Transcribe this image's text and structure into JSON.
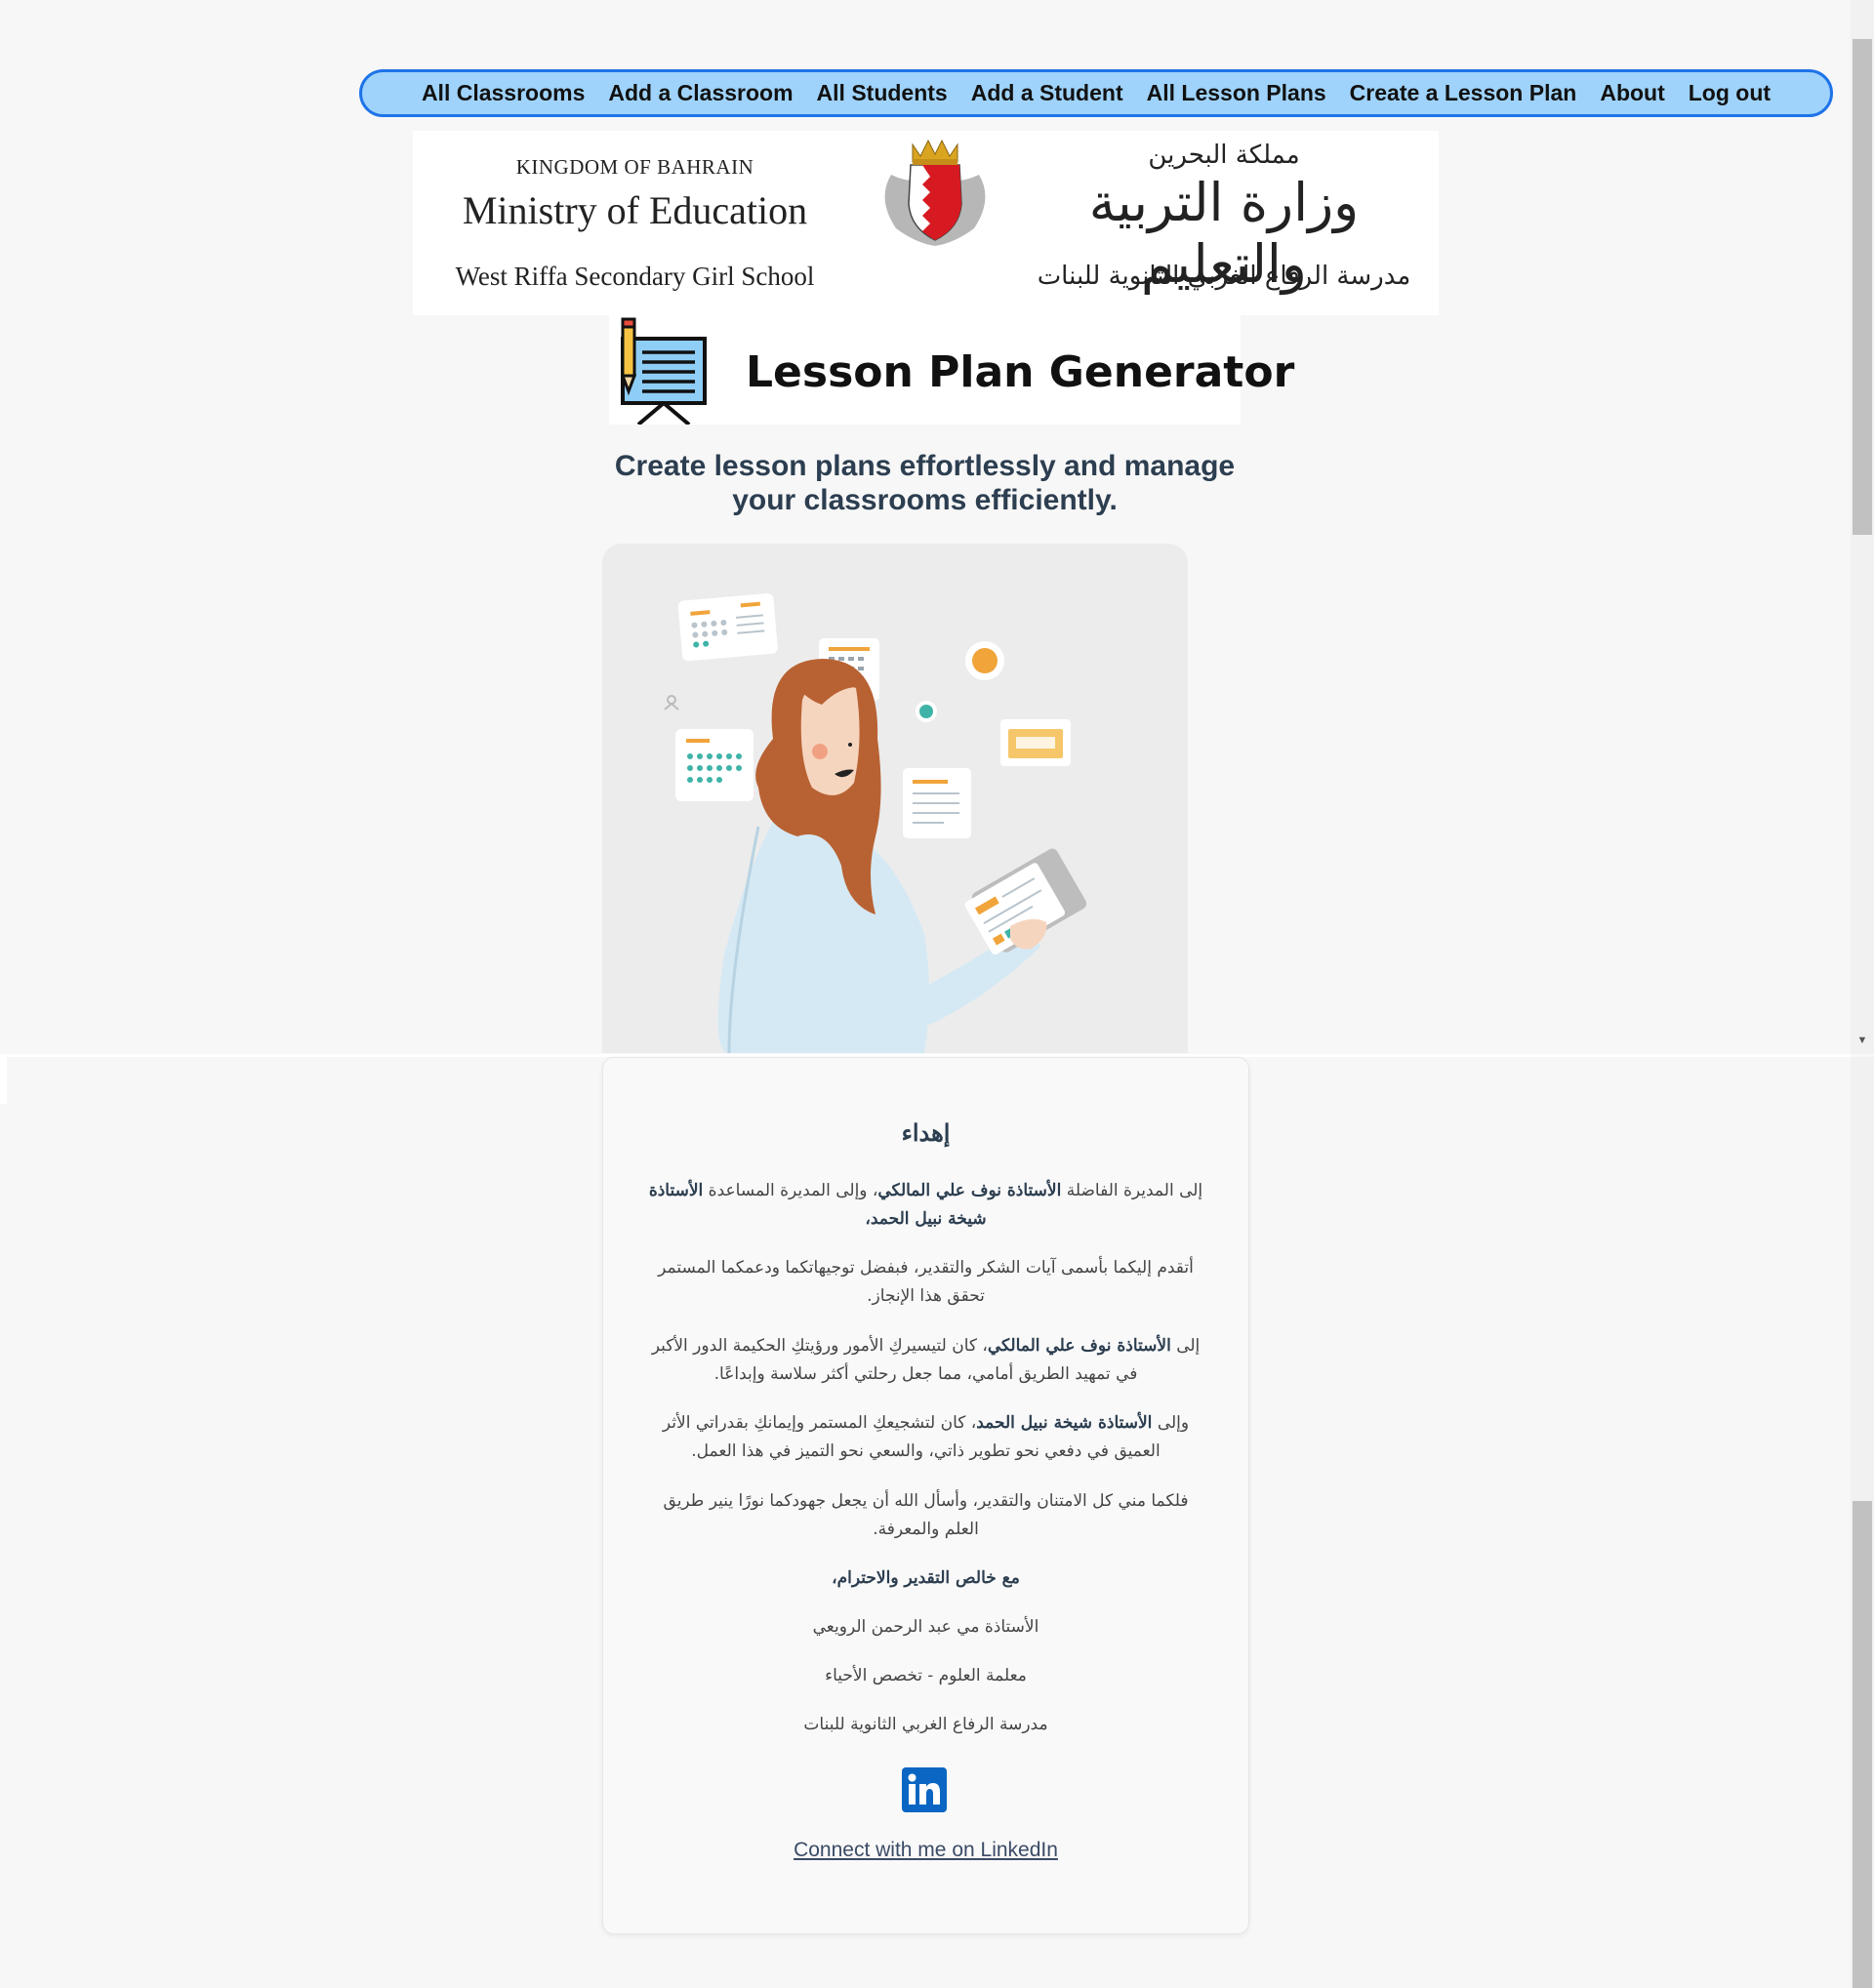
{
  "nav": {
    "items": [
      "All Classrooms",
      "Add a Classroom",
      "All Students",
      "Add a Student",
      "All Lesson Plans",
      "Create a Lesson Plan",
      "About",
      "Log out"
    ]
  },
  "banner": {
    "kingdom_en": "KINGDOM OF BAHRAIN",
    "ministry_en": "Ministry of Education",
    "school_en": "West Riffa Secondary Girl School",
    "kingdom_ar": "مملكة البحرين",
    "ministry_ar": "وزارة التربية والتعليم",
    "school_ar": "مدرسة الرفاع الغربي الثانوية للبنات"
  },
  "header": {
    "title": "Lesson Plan Generator",
    "tagline_line1": "Create lesson plans effortlessly and manage",
    "tagline_line2": "your classrooms efficiently."
  },
  "dedication": {
    "title": "إهداء",
    "p1_a": "إلى المديرة الفاضلة ",
    "p1_b": "الأستاذة نوف علي المالكي",
    "p1_c": "، وإلى المديرة المساعدة ",
    "p1_d": "الأستاذة شيخة نبيل الحمد",
    "p1_e": "،",
    "p2": "أتقدم إليكما بأسمى آيات الشكر والتقدير، فبفضل توجيهاتكما ودعمكما المستمر تحقق هذا الإنجاز.",
    "p3_a": "إلى ",
    "p3_b": "الأستاذة نوف علي المالكي",
    "p3_c": "، كان لتيسيركِ الأمور ورؤيتكِ الحكيمة الدور الأكبر في تمهيد الطريق أمامي، مما جعل رحلتي أكثر سلاسة وإبداعًا.",
    "p4_a": "وإلى ",
    "p4_b": "الأستاذة شيخة نبيل الحمد",
    "p4_c": "، كان لتشجيعكِ المستمر وإيمانكِ بقدراتي الأثر العميق في دفعي نحو تطوير ذاتي، والسعي نحو التميز في هذا العمل.",
    "p5": "فلكما مني كل الامتنان والتقدير، وأسأل الله أن يجعل جهودكما نورًا ينير طريق العلم والمعرفة.",
    "closing": "مع خالص التقدير والاحترام،",
    "sign_name": "الأستاذة مي عبد الرحمن الرويعي",
    "sign_role": "معلمة العلوم - تخصص الأحياء",
    "sign_school": "مدرسة الرفاع الغربي الثانوية للبنات",
    "linkedin_text": "Connect with me on LinkedIn"
  },
  "colors": {
    "nav_bg": "#9fd3fb",
    "nav_border": "#1e73e8",
    "linkedin_blue": "#0a66c2",
    "heading": "#2c3e50"
  },
  "icons": [
    "bahrain-crest-icon",
    "lesson-board-icon",
    "linkedin-icon"
  ]
}
